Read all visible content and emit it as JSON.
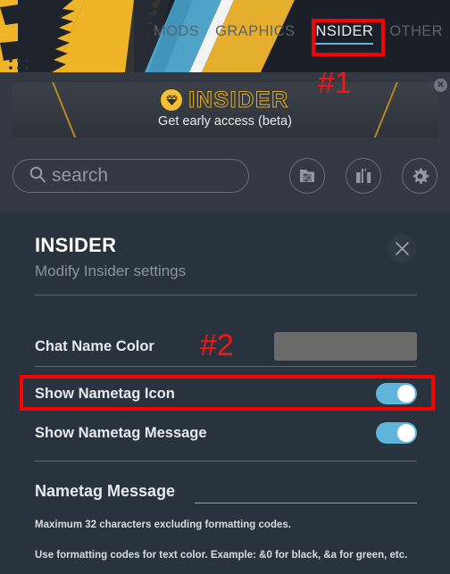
{
  "header": {
    "nav": [
      {
        "label": "MODS",
        "active": false
      },
      {
        "label": "GRAPHICS",
        "active": false
      },
      {
        "label": "INSIDER",
        "active": true
      },
      {
        "label": "OTHER",
        "active": false
      }
    ],
    "accent_color": "#63b6dd",
    "background_color": "#1b1f27"
  },
  "promo": {
    "title": "INSIDER",
    "subtitle": "Get early access (beta)",
    "gem_icon": "diamond-icon",
    "close_icon": "close-icon",
    "gold_color": "#e0ab27"
  },
  "search": {
    "placeholder": "search",
    "icon": "search-icon",
    "buttons": [
      {
        "name": "list-settings-icon"
      },
      {
        "name": "columns-chart-icon"
      },
      {
        "name": "gear-icon"
      }
    ]
  },
  "panel": {
    "title": "INSIDER",
    "subtitle": "Modify Insider settings",
    "close_icon": "close-icon",
    "background_color": "#29333d",
    "rows": [
      {
        "label": "Chat Name Color",
        "type": "color",
        "value_color": "#6b6b6b"
      },
      {
        "label": "Show Nametag Icon",
        "type": "toggle",
        "value": "on"
      },
      {
        "label": "Show Nametag Message",
        "type": "toggle",
        "value": "on"
      }
    ],
    "text_field": {
      "label": "Nametag Message",
      "value": ""
    },
    "hints": [
      "Maximum 32 characters excluding formatting codes.",
      "Use formatting codes for text color. Example: &0 for black, &a for green, etc."
    ],
    "toggle_on_color": "#5fb5da"
  },
  "annotations": {
    "color": "#f61515",
    "markers": [
      {
        "label": "#1",
        "target": "nav-item-insider"
      },
      {
        "label": "#2",
        "target": "show-nametag-icon-row"
      }
    ]
  }
}
